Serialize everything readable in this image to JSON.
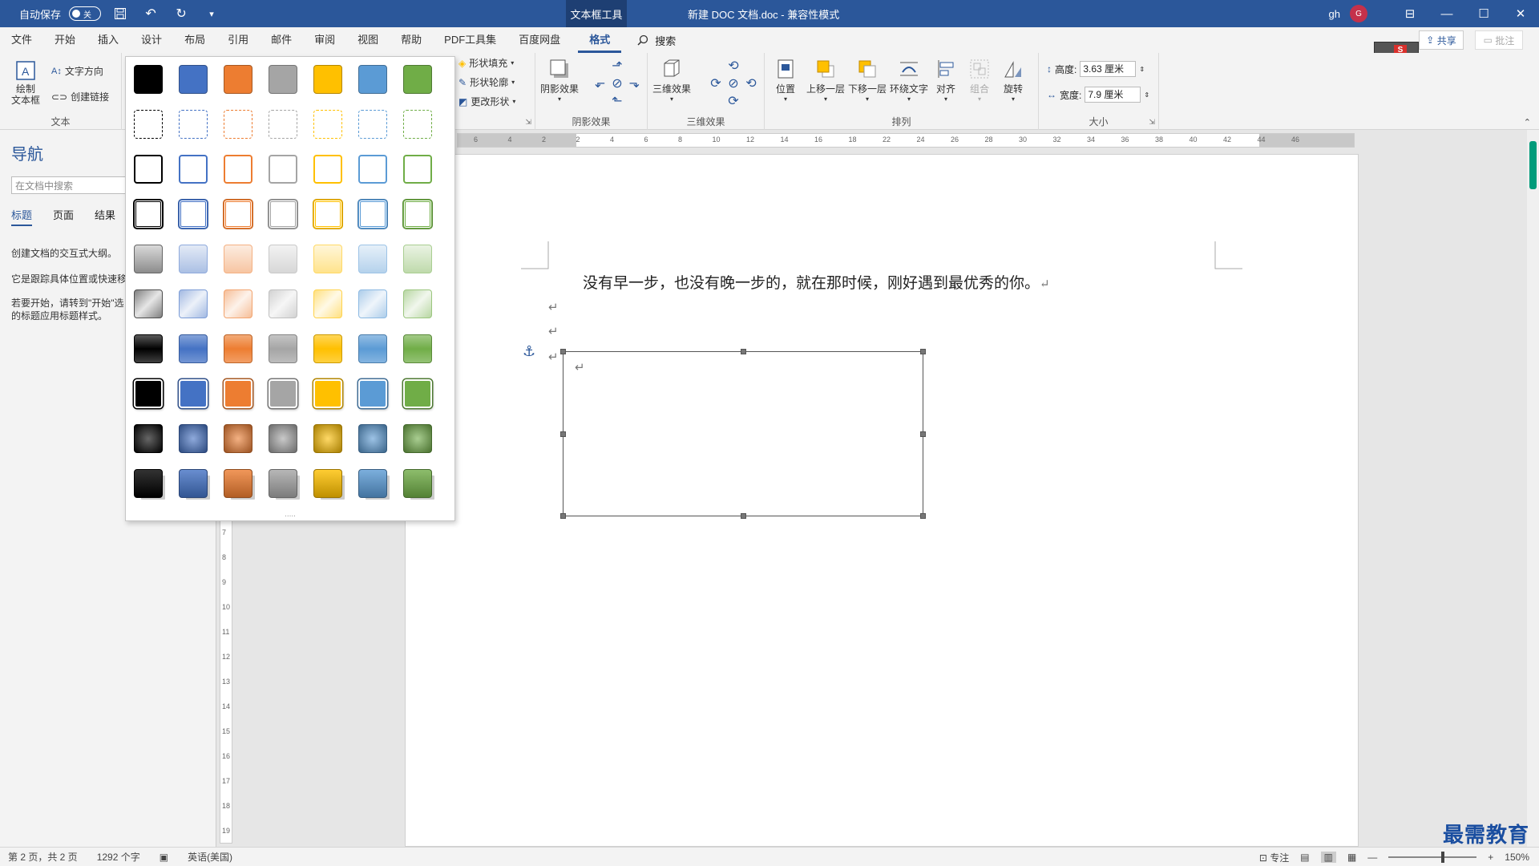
{
  "titlebar": {
    "autosave_label": "自动保存",
    "autosave_state": "关",
    "context_tab": "文本框工具",
    "doc_title": "新建 DOC 文档.doc  -  兼容性模式",
    "user": "gh",
    "avatar_letter": "G",
    "minimize": "—",
    "restore": "☐",
    "close": "✕",
    "ribbon_display": "⊟",
    "save_icon": "💾",
    "undo_icon": "↶",
    "redo_icon": "↻",
    "customize_icon": "▾"
  },
  "tabs": [
    "文件",
    "开始",
    "插入",
    "设计",
    "布局",
    "引用",
    "邮件",
    "审阅",
    "视图",
    "帮助",
    "PDF工具集",
    "百度网盘",
    "格式"
  ],
  "active_tab": "格式",
  "search_label": "搜索",
  "share_label": "共享",
  "comment_label": "批注",
  "ribbon": {
    "text_group": {
      "draw_textbox": "绘制\n文本框",
      "text_direction": "文字方向",
      "create_link": "创建链接",
      "label": "文本"
    },
    "shape_styles": {
      "fill": "形状填充",
      "outline": "形状轮廓",
      "change_shape": "更改形状"
    },
    "shadow_group": {
      "shadow_effect": "阴影效果",
      "label": "阴影效果"
    },
    "threed_group": {
      "threed_effect": "三维效果",
      "label": "三维效果"
    },
    "arrange_group": {
      "position": "位置",
      "bring_forward": "上移一层",
      "send_backward": "下移一层",
      "wrap_text": "环绕文字",
      "align": "对齐",
      "group": "组合",
      "rotate": "旋转",
      "label": "排列"
    },
    "size_group": {
      "height_label": "高度:",
      "height_value": "3.63 厘米",
      "width_label": "宽度:",
      "width_value": "7.9 厘米",
      "label": "大小"
    }
  },
  "nav": {
    "title": "导航",
    "search_placeholder": "在文档中搜索",
    "tabs": [
      "标题",
      "页面",
      "结果"
    ],
    "text1": "创建文档的交互式大纲。",
    "text2": "它是跟踪具体位置或快速移",
    "text3a": "若要开始，请转到\"开始\"选",
    "text3b": "的标题应用标题样式。"
  },
  "document": {
    "line1": "没有早一步，也没有晚一步的，就在那时候，刚好遇到最优秀的你。",
    "para_mark": "↵",
    "anchor_icon": "⚓"
  },
  "ruler": {
    "ticks": [
      "6",
      "4",
      "2",
      "2",
      "4",
      "6",
      "8",
      "10",
      "12",
      "14",
      "16",
      "18",
      "22",
      "24",
      "26",
      "28",
      "30",
      "32",
      "34",
      "36",
      "38",
      "40",
      "42",
      "44",
      "46"
    ]
  },
  "vruler_ticks": [
    "7",
    "8",
    "9",
    "10",
    "11",
    "12",
    "13",
    "14",
    "15",
    "16",
    "17",
    "18",
    "19"
  ],
  "gallery": {
    "colors": [
      "#000000",
      "#4472c4",
      "#ed7d31",
      "#a5a5a5",
      "#ffc000",
      "#5b9bd5",
      "#70ad47"
    ],
    "more": "....."
  },
  "statusbar": {
    "page": "第 2 页，共 2 页",
    "words": "1292 个字",
    "language": "英语(美国)",
    "focus": "专注",
    "zoom": "150%",
    "zoom_minus": "—",
    "zoom_plus": "+"
  },
  "watermark": "最需教育"
}
